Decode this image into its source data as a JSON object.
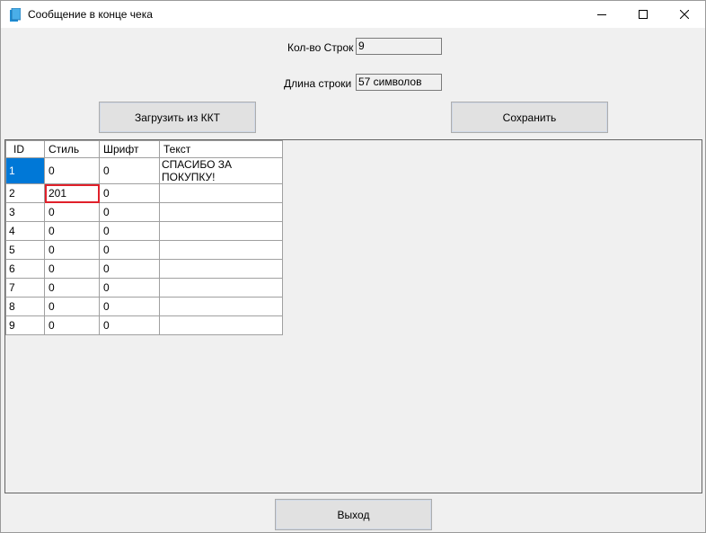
{
  "window": {
    "title": "Сообщение в конце чека",
    "icon": "document-icon",
    "controls": {
      "minimize": "minimize-icon",
      "maximize": "maximize-icon",
      "close": "close-icon"
    }
  },
  "form": {
    "rows_label": "Кол-во Строк",
    "rows_value": "9",
    "length_label": "Длина строки",
    "length_value": "57 символов"
  },
  "buttons": {
    "load": "Загрузить из ККТ",
    "save": "Сохранить",
    "exit": "Выход"
  },
  "table": {
    "headers": [
      "ID",
      "Стиль",
      "Шрифт",
      "Текст"
    ],
    "rows": [
      [
        "1",
        "0",
        "0",
        "СПАСИБО ЗА ПОКУПКУ!"
      ],
      [
        "2",
        "201",
        "0",
        ""
      ],
      [
        "3",
        "0",
        "0",
        ""
      ],
      [
        "4",
        "0",
        "0",
        ""
      ],
      [
        "5",
        "0",
        "0",
        ""
      ],
      [
        "6",
        "0",
        "0",
        ""
      ],
      [
        "7",
        "0",
        "0",
        ""
      ],
      [
        "8",
        "0",
        "0",
        ""
      ],
      [
        "9",
        "0",
        "0",
        ""
      ]
    ]
  },
  "colors": {
    "selection": "#0078d7",
    "edit_border": "#e0202a",
    "icon_blue": "#1e90d8"
  }
}
